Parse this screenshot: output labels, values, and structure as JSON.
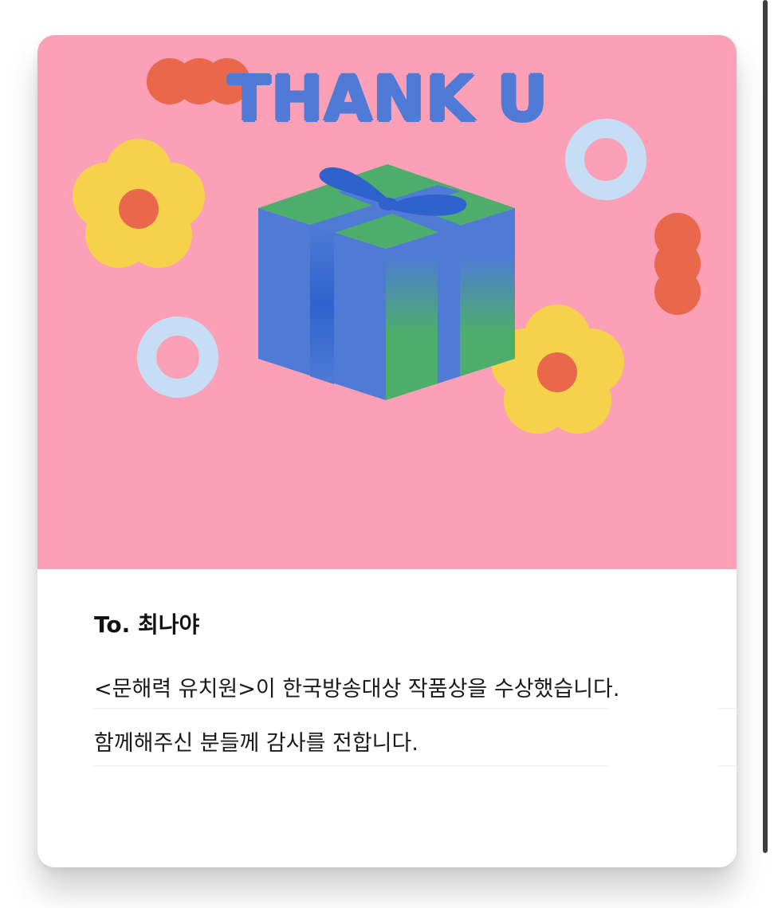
{
  "card": {
    "hero": {
      "title": "THANK U",
      "background_color": "#fba0b6",
      "illustration": "gift-box-with-flowers"
    },
    "message": {
      "to": "To.  최나야",
      "lines": [
        "<문해력 유치원>이 한국방송대상 작품상을 수상했습니다.",
        "함께해주신 분들께 감사를 전합니다."
      ]
    }
  },
  "colors": {
    "title": "#4f7bd6",
    "flower_petal": "#f5d14c",
    "flower_center": "#e9674a",
    "ring": "#c6def5",
    "box_blue": "#4f7bd6",
    "box_green": "#4cae6a",
    "ribbon": "#2f62cc"
  }
}
